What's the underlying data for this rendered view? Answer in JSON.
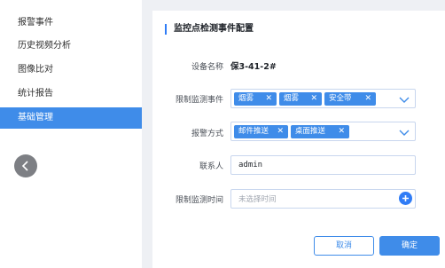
{
  "sidebar": {
    "items": [
      {
        "label": "报警事件"
      },
      {
        "label": "历史视频分析"
      },
      {
        "label": "图像比对"
      },
      {
        "label": "统计报告"
      },
      {
        "label": "基础管理",
        "active": true
      }
    ],
    "collapse_icon": "chevron-left-icon"
  },
  "panel": {
    "title": "监控点检测事件配置",
    "device_name": {
      "label": "设备名称",
      "value": "保3-41-2#"
    },
    "limit_events": {
      "label": "限制监测事件",
      "tags": [
        "烟雾",
        "烟雾",
        "安全带"
      ]
    },
    "alarm_method": {
      "label": "报警方式",
      "tags": [
        "邮件推送",
        "桌面推送"
      ]
    },
    "contact": {
      "label": "联系人",
      "value": "admin"
    },
    "limit_time": {
      "label": "限制监测时间",
      "placeholder": "未选择时间"
    },
    "buttons": {
      "cancel": "取消",
      "confirm": "确定"
    }
  },
  "colors": {
    "accent": "#3f8ce9",
    "sidebar_bg": "#ffffff",
    "page_bg": "#eef0f4"
  }
}
